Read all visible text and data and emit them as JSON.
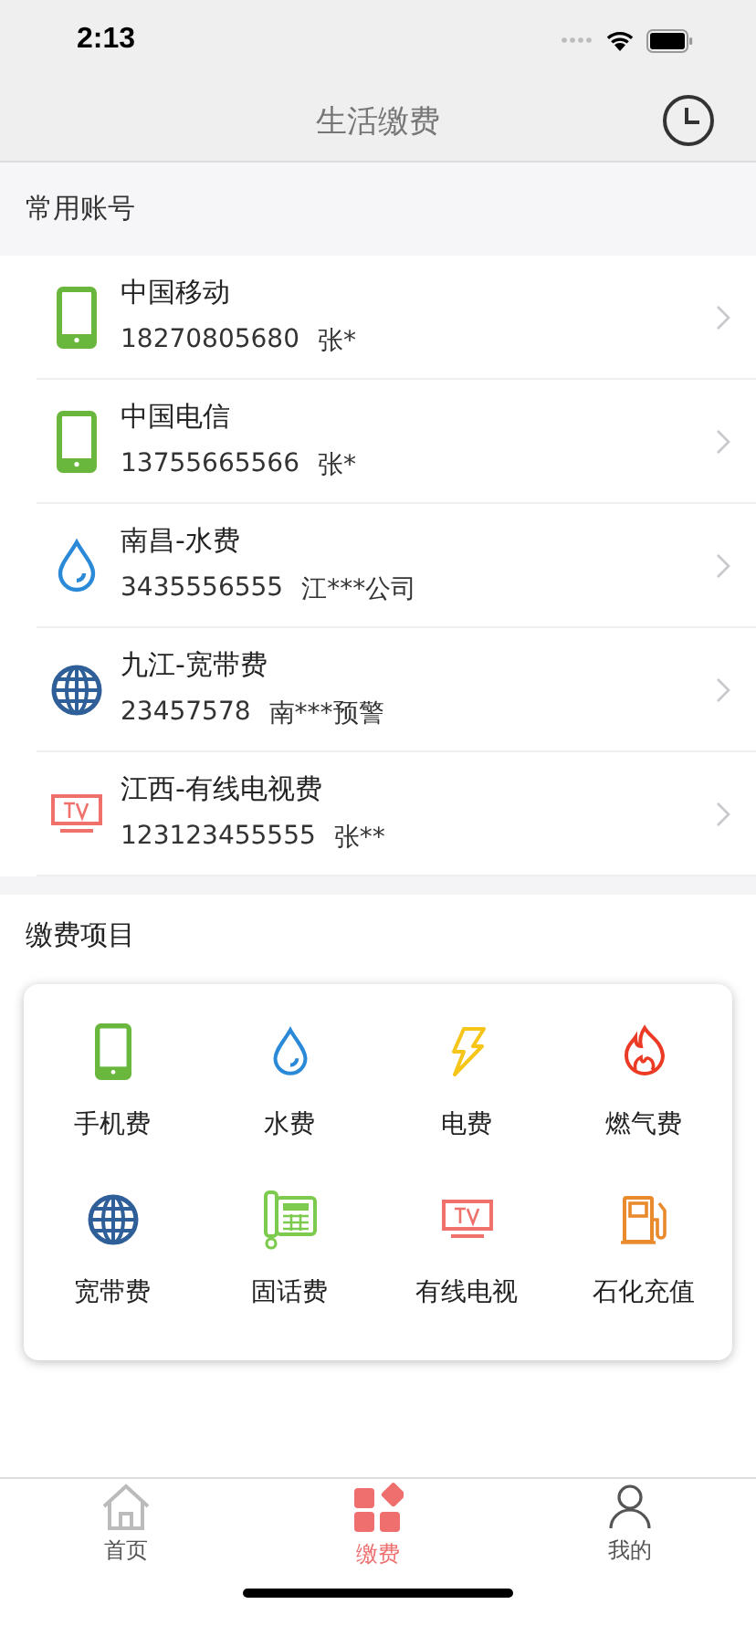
{
  "status_bar": {
    "time": "2:13"
  },
  "nav": {
    "title": "生活缴费"
  },
  "accounts_section": {
    "title": "常用账号"
  },
  "accounts": [
    {
      "kind": "phone",
      "name": "中国移动",
      "number": "18270805680",
      "holder": "张*"
    },
    {
      "kind": "phone",
      "name": "中国电信",
      "number": "13755665566",
      "holder": "张*"
    },
    {
      "kind": "water",
      "name": "南昌-水费",
      "number": "3435556555",
      "holder": "江***公司"
    },
    {
      "kind": "globe",
      "name": "九江-宽带费",
      "number": "23457578",
      "holder": "南***预警"
    },
    {
      "kind": "tv",
      "name": "江西-有线电视费",
      "number": "123123455555",
      "holder": "张**"
    }
  ],
  "services_section": {
    "title": "缴费项目"
  },
  "services": [
    {
      "kind": "phone",
      "label": "手机费"
    },
    {
      "kind": "water",
      "label": "水费"
    },
    {
      "kind": "power",
      "label": "电费"
    },
    {
      "kind": "gas",
      "label": "燃气费"
    },
    {
      "kind": "globe",
      "label": "宽带费"
    },
    {
      "kind": "landline",
      "label": "固话费"
    },
    {
      "kind": "tv",
      "label": "有线电视"
    },
    {
      "kind": "fuel",
      "label": "石化充值"
    }
  ],
  "tabs": [
    {
      "kind": "home",
      "label": "首页",
      "selected": false
    },
    {
      "kind": "grid",
      "label": "缴费",
      "selected": true
    },
    {
      "kind": "person",
      "label": "我的",
      "selected": false
    }
  ]
}
